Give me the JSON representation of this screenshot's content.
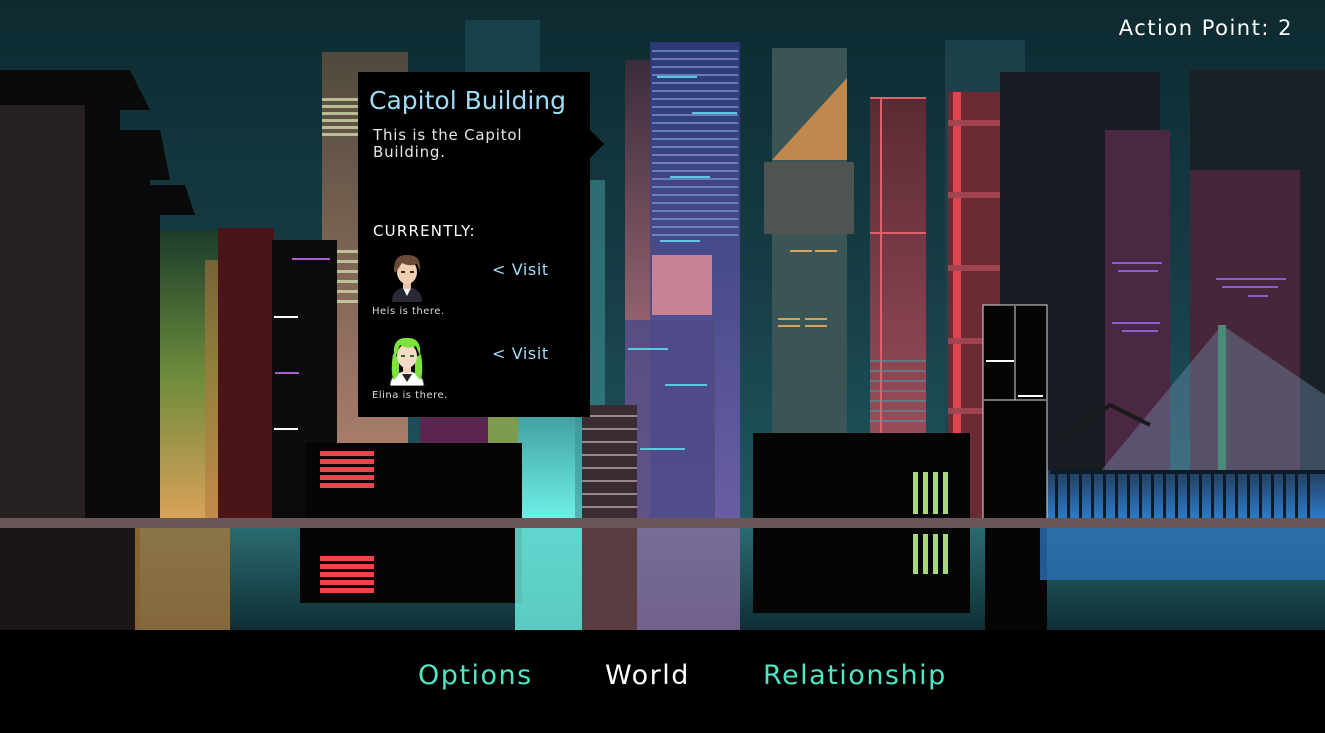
{
  "hud": {
    "action_points_label": "Action Point:",
    "action_points_value": "2"
  },
  "location_panel": {
    "title": "Capitol Building",
    "description": "This is the Capitol Building.",
    "currently_label": "CURRENTLY:",
    "characters": [
      {
        "status": "Heis is there.",
        "visit_label": "< Visit",
        "hair_color": "#6b4a38"
      },
      {
        "status": "Elina is there.",
        "visit_label": "< Visit",
        "hair_color": "#7de33c"
      }
    ]
  },
  "bottom_nav": {
    "items": [
      {
        "label": "Options",
        "color": "#4fe6c6"
      },
      {
        "label": "World",
        "color": "#ffffff"
      },
      {
        "label": "Relationship",
        "color": "#4fe6c6"
      }
    ]
  },
  "colors": {
    "accent_text": "#9fdcf5",
    "nav_active": "#ffffff",
    "nav_inactive": "#4fe6c6"
  }
}
